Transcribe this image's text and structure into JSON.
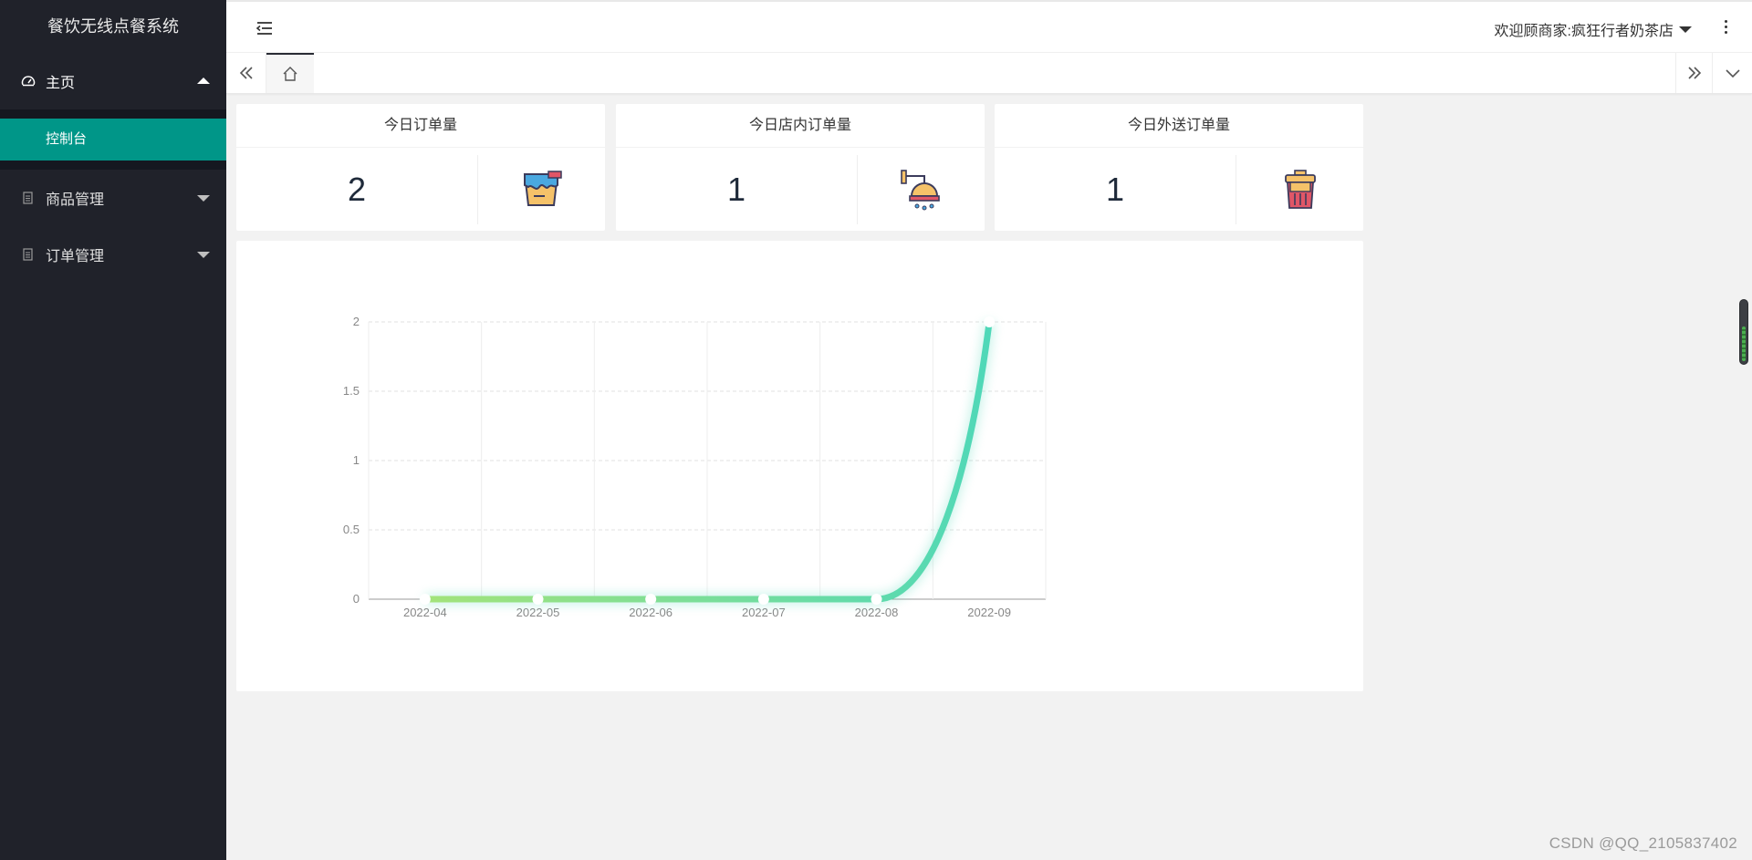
{
  "app": {
    "title": "餐饮无线点餐系统"
  },
  "sidebar": {
    "items": [
      {
        "label": "主页",
        "icon": "dashboard-icon",
        "expanded": true,
        "children": [
          {
            "label": "控制台",
            "active": true
          }
        ]
      },
      {
        "label": "商品管理",
        "icon": "file-icon",
        "expanded": false
      },
      {
        "label": "订单管理",
        "icon": "file-icon",
        "expanded": false
      }
    ],
    "accent": "#009688",
    "background": "#20222a"
  },
  "header": {
    "toggle_icon": "menu-fold-icon",
    "user_label": "欢迎顾商家:疯狂行者奶茶店",
    "more_icon": "more-vertical-icon"
  },
  "tabs": {
    "prev_icon": "double-left-icon",
    "home_icon": "home-icon",
    "next_icon": "double-right-icon",
    "menu_icon": "chevron-down-icon"
  },
  "cards": [
    {
      "title": "今日订单量",
      "value": "2",
      "icon": "paint-bucket-icon"
    },
    {
      "title": "今日店内订单量",
      "value": "1",
      "icon": "shower-icon"
    },
    {
      "title": "今日外送订单量",
      "value": "1",
      "icon": "trash-bin-icon"
    }
  ],
  "chart_data": {
    "type": "line",
    "title": "",
    "xlabel": "",
    "ylabel": "",
    "x": [
      "2022-04",
      "2022-05",
      "2022-06",
      "2022-07",
      "2022-08",
      "2022-09"
    ],
    "series": [
      {
        "values": [
          0,
          0,
          0,
          0,
          0,
          2
        ]
      }
    ],
    "y_ticks": [
      "0",
      "0.5",
      "1",
      "1.5",
      "2"
    ],
    "ylim": [
      0,
      2
    ],
    "grid": true,
    "smooth": true,
    "colors": {
      "start": "#a3e37a",
      "end": "#4fd8b8"
    }
  },
  "watermark": "CSDN @QQ_2105837402"
}
